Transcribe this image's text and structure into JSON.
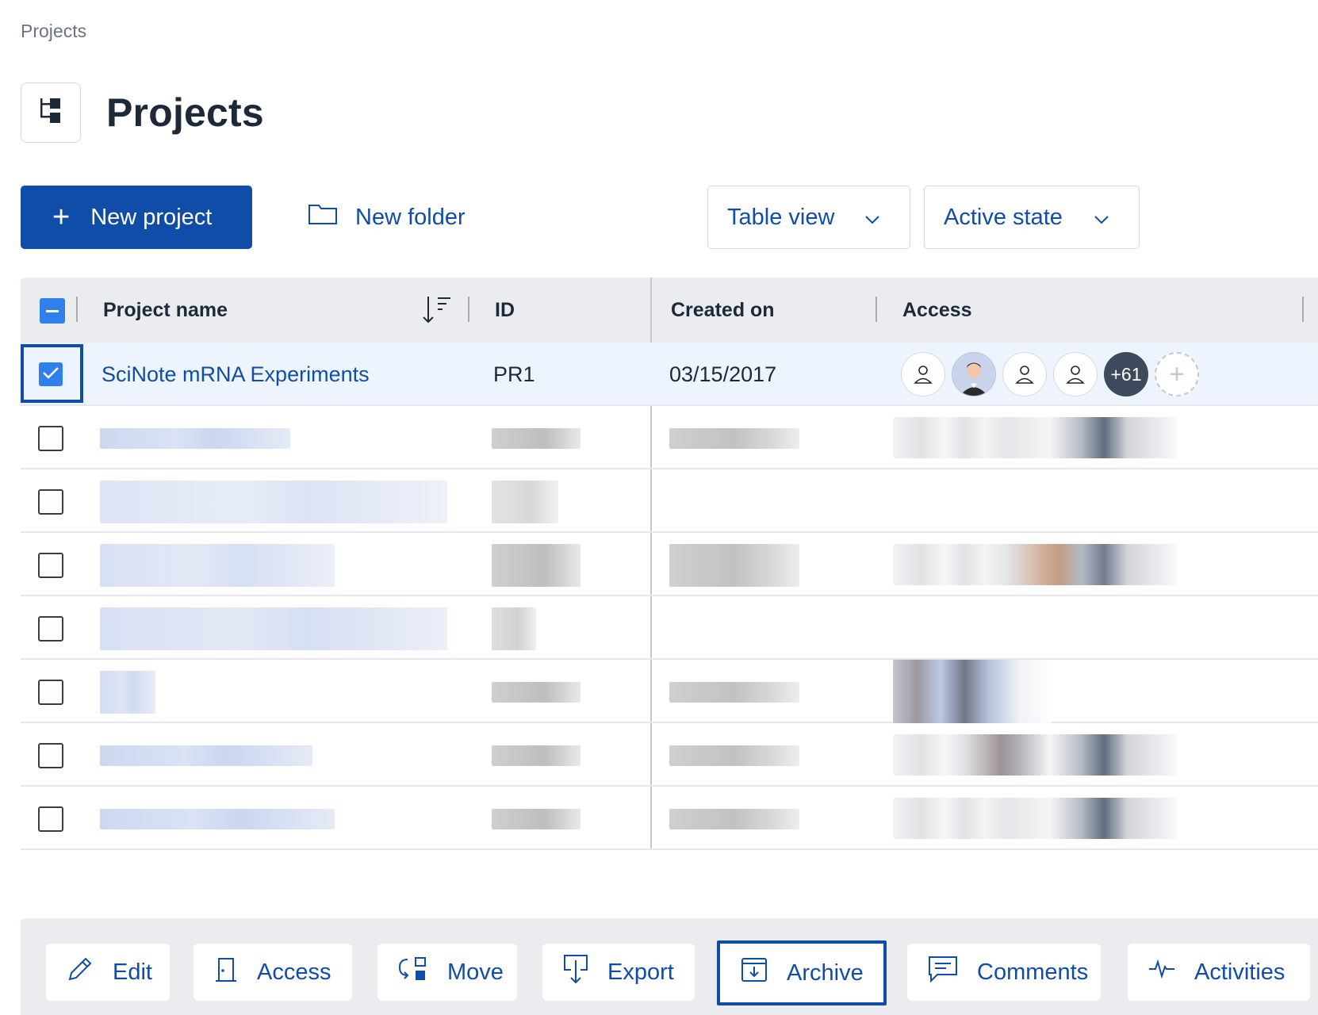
{
  "breadcrumb": "Projects",
  "page_title": "Projects",
  "toolbar": {
    "new_project": "New project",
    "new_folder": "New folder",
    "view_dropdown": "Table view",
    "state_dropdown": "Active state"
  },
  "table": {
    "headers": {
      "name": "Project name",
      "id": "ID",
      "created": "Created on",
      "access": "Access"
    },
    "rows": [
      {
        "name": "SciNote mRNA Experiments",
        "id": "PR1",
        "created": "03/15/2017",
        "selected": true,
        "more_users": "+61"
      }
    ]
  },
  "actions": {
    "edit": "Edit",
    "access": "Access",
    "move": "Move",
    "export": "Export",
    "archive": "Archive",
    "comments": "Comments",
    "activities": "Activities"
  },
  "colors": {
    "primary": "#104da9",
    "checkbox_blue": "#2f80ed",
    "header_bg": "#eaecf0",
    "selected_row_bg": "#edf4fd"
  }
}
